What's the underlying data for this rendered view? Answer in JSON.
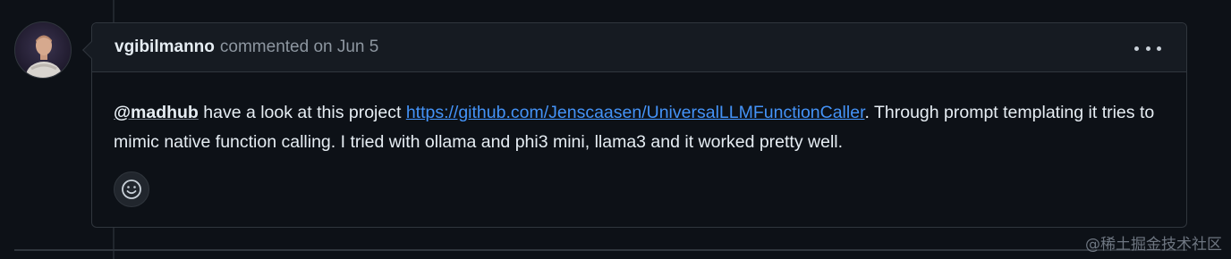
{
  "comment": {
    "author": "vgibilmanno",
    "meta": "commented on Jun 5",
    "body": {
      "mention": "@madhub",
      "text_1": " have a look at this project ",
      "link": "https://github.com/Jenscaasen/UniversalLLMFunctionCaller",
      "text_2": ". Through prompt templating it tries to mimic native function calling. I tried with ollama and phi3 mini, llama3 and it worked pretty well."
    }
  },
  "icons": {
    "options": "kebab-horizontal-icon",
    "reaction": "smiley-icon"
  },
  "watermark": "@稀土掘金技术社区"
}
